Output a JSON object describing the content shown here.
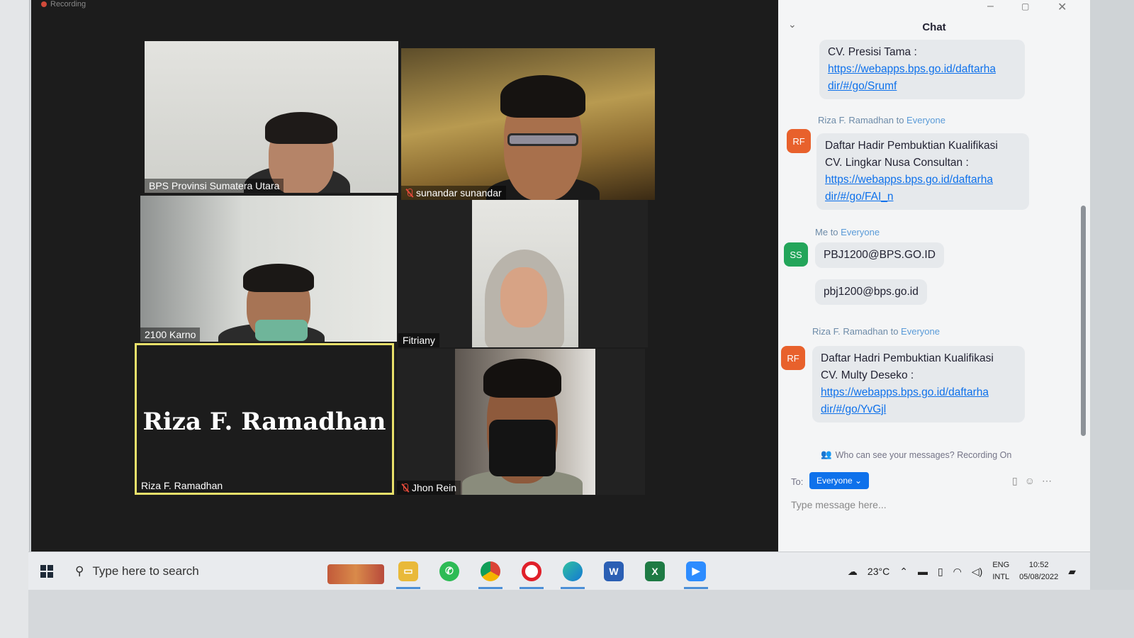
{
  "recording": {
    "label": "Recording"
  },
  "participants": [
    {
      "name": "BPS Provinsi Sumatera Utara",
      "muted": false
    },
    {
      "name": "sunandar sunandar",
      "muted": true
    },
    {
      "name": "2100 Karno",
      "muted": false
    },
    {
      "name": "Fitriany",
      "muted": false
    },
    {
      "name": "Riza F. Ramadhan",
      "muted": false,
      "video_off_label": "Riza F. Ramadhan",
      "active_speaker": true
    },
    {
      "name": "Jhon Rein",
      "muted": true
    }
  ],
  "chat": {
    "title": "Chat",
    "messages": [
      {
        "text_lines": [
          "CV. Presisi Tama :"
        ],
        "link": "https://webapps.bps.go.id/daftarhadir/#/go/Srumf",
        "link_lines": [
          "https://webapps.bps.go.id/daftarha",
          "dir/#/go/Srumf"
        ]
      },
      {
        "sender": "Riza F. Ramadhan",
        "to": "to",
        "recipient": "Everyone",
        "avatar": "RF",
        "avatar_color": "#e8612c",
        "text_lines": [
          "Daftar Hadir Pembuktian Kualifikasi",
          "CV. Lingkar Nusa Consultan :"
        ],
        "link_lines": [
          "https://webapps.bps.go.id/daftarha",
          "dir/#/go/FAI_n"
        ]
      },
      {
        "sender": "Me",
        "to": "to",
        "recipient": "Everyone",
        "avatar": "SS",
        "avatar_color": "#23a55a",
        "bubbles": [
          "PBJ1200@BPS.GO.ID",
          "pbj1200@bps.go.id"
        ]
      },
      {
        "sender": "Riza F. Ramadhan",
        "to": "to",
        "recipient": "Everyone",
        "avatar": "RF",
        "avatar_color": "#e8612c",
        "text_lines": [
          "Daftar Hadri Pembuktian Kualifikasi",
          "CV. Multy Deseko :"
        ],
        "link_lines": [
          "https://webapps.bps.go.id/daftarha",
          "dir/#/go/YvGjl"
        ]
      }
    ],
    "notice": "Who can see your messages? Recording On",
    "to_label": "To:",
    "to_value": "Everyone",
    "input_placeholder": "Type message here..."
  },
  "taskbar": {
    "search_placeholder": "Type here to search",
    "apps": [
      "file-explorer",
      "whatsapp",
      "chrome",
      "opera",
      "edge",
      "word",
      "excel",
      "zoom"
    ],
    "temperature": "23°C",
    "lang_top": "ENG",
    "lang_bottom": "INTL",
    "time": "10:52",
    "date": "05/08/2022"
  }
}
